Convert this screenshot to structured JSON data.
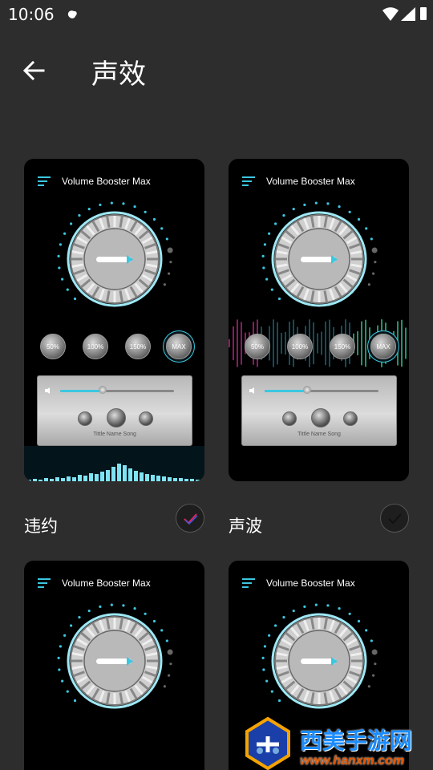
{
  "status_bar": {
    "time": "10:06"
  },
  "app_bar": {
    "title": "声效",
    "back_icon": "arrow-left-icon"
  },
  "cards": [
    {
      "header": "Volume Booster Max",
      "label": "违约",
      "selected": true,
      "buttons": [
        "50%",
        "100%",
        "150%",
        "MAX"
      ],
      "song": "Tittle Name Song",
      "accent": "#3bc7e0",
      "check_color": "#e0245e"
    },
    {
      "header": "Volume Booster Max",
      "label": "声波",
      "selected": false,
      "buttons": [
        "50%",
        "100%",
        "150%",
        "MAX"
      ],
      "song": "Tittle Name Song",
      "accent": "#3bc7e0",
      "check_color": "#111111"
    },
    {
      "header": "Volume Booster Max"
    },
    {
      "header": "Volume Booster Max"
    }
  ],
  "watermark": {
    "name": "西美手游网",
    "url": "www.hanxm.com"
  }
}
